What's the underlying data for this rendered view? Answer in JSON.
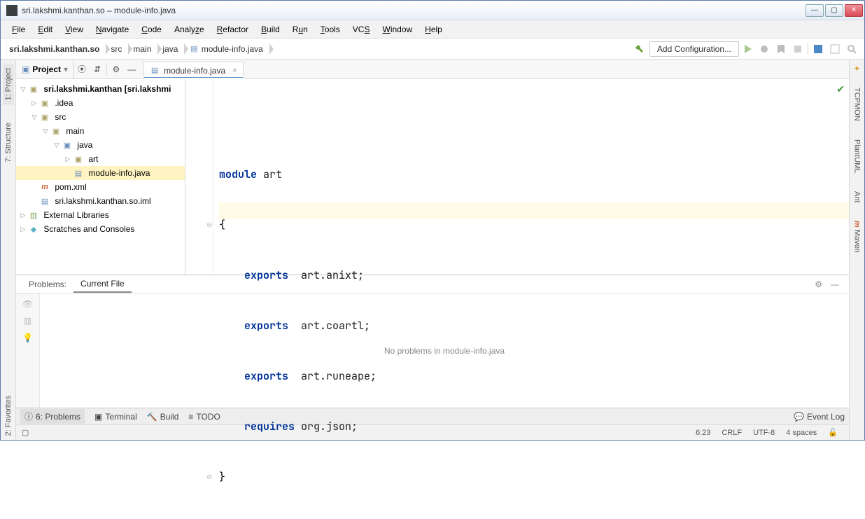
{
  "window": {
    "title": "sri.lakshmi.kanthan.so – module-info.java"
  },
  "menu": [
    "File",
    "Edit",
    "View",
    "Navigate",
    "Code",
    "Analyze",
    "Refactor",
    "Build",
    "Run",
    "Tools",
    "VCS",
    "Window",
    "Help"
  ],
  "breadcrumbs": [
    "sri.lakshmi.kanthan.so",
    "src",
    "main",
    "java",
    "module-info.java"
  ],
  "runConfig": "Add Configuration...",
  "projectSelector": "Project",
  "fileTab": "module-info.java",
  "tree": {
    "root": "sri.lakshmi.kanthan [sri.lakshmi",
    "idea": ".idea",
    "src": "src",
    "main": "main",
    "java": "java",
    "art": "art",
    "moduleInfo": "module-info.java",
    "pom": "pom.xml",
    "iml": "sri.lakshmi.kanthan.so.iml",
    "ext": "External Libraries",
    "scratch": "Scratches and Consoles"
  },
  "code": {
    "l1a": "module",
    "l1b": " art",
    "l2": "{",
    "l3a": "exports",
    "l3b": "  art.anixt;",
    "l4a": "exports",
    "l4b": "  art.coartl;",
    "l5a": "exports",
    "l5b": "  art.runeape;",
    "l6a": "requires",
    "l6b": " org.json;",
    "l7": "}"
  },
  "problems": {
    "tab1": "Problems:",
    "tab2": "Current File",
    "message": "No problems in module-info.java"
  },
  "bottomTools": {
    "problems": "6: Problems",
    "terminal": "Terminal",
    "build": "Build",
    "todo": "TODO",
    "eventlog": "Event Log"
  },
  "rightTabs": [
    "TCPMON",
    "PlantUML",
    "Ant",
    "Maven"
  ],
  "leftTabs": [
    "1: Project",
    "7: Structure",
    "2: Favorites"
  ],
  "status": {
    "pos": "6:23",
    "eol": "CRLF",
    "enc": "UTF-8",
    "indent": "4 spaces"
  }
}
